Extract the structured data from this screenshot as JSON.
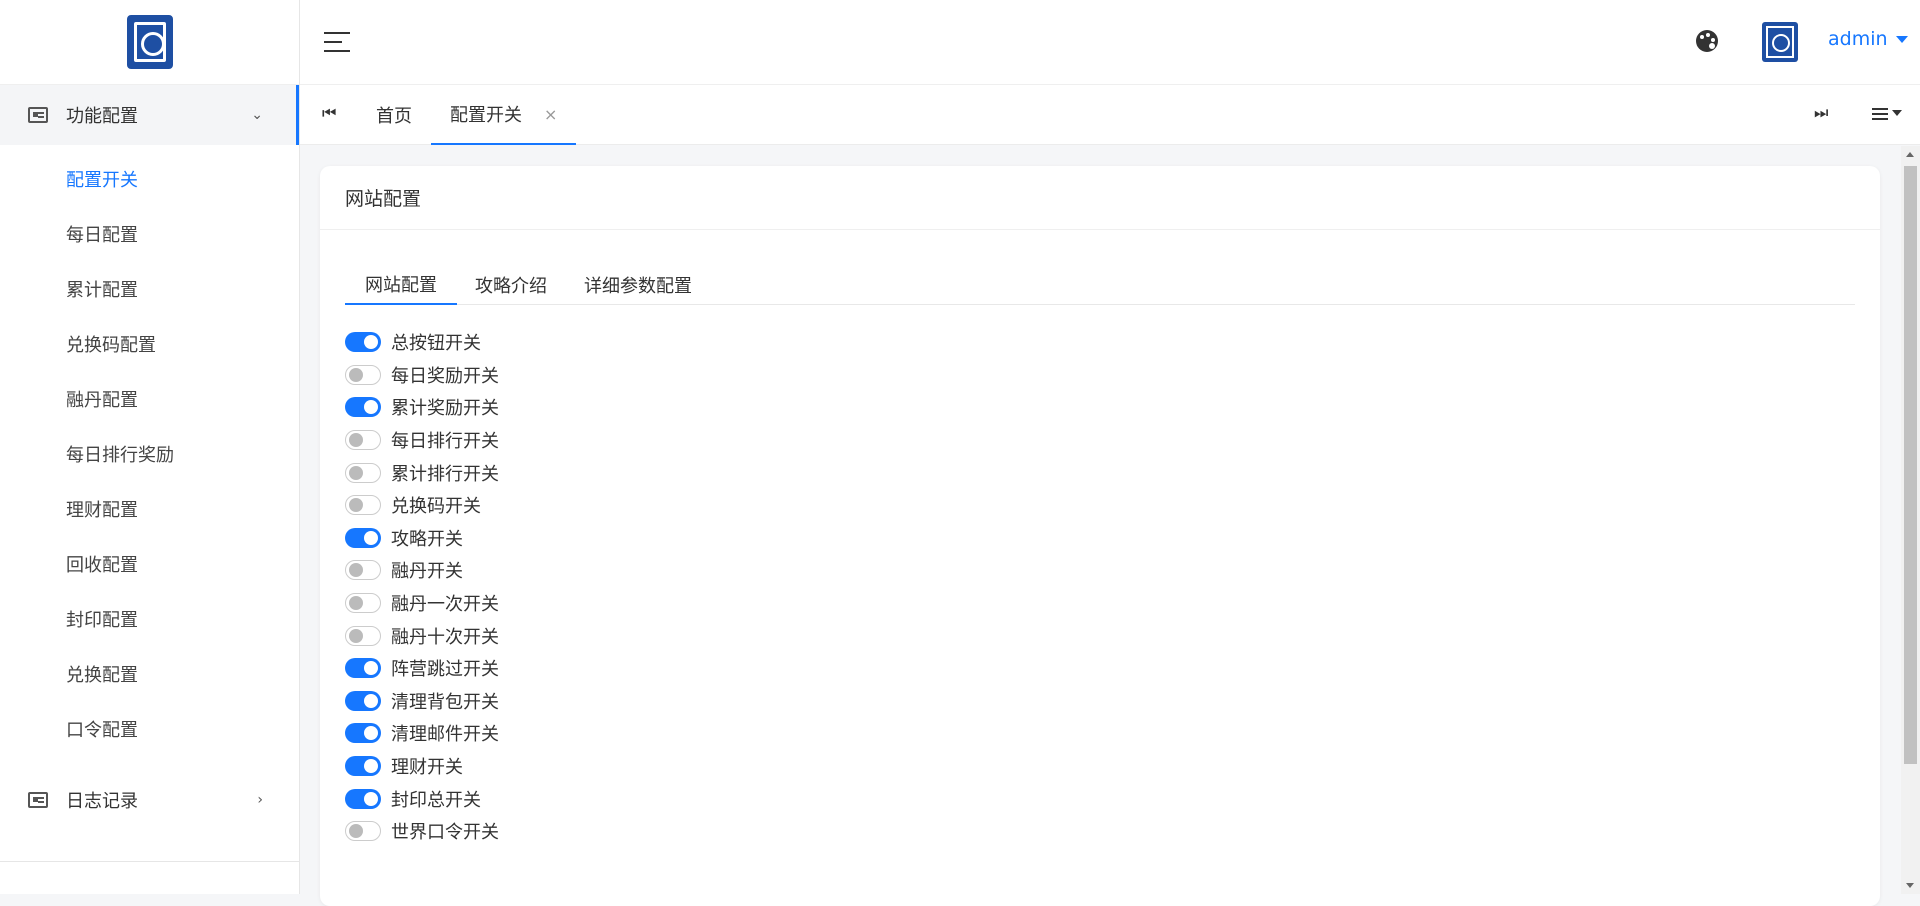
{
  "sidebar": {
    "groups": [
      {
        "label": "功能配置",
        "expanded": true,
        "items": [
          {
            "label": "配置开关",
            "active": true
          },
          {
            "label": "每日配置"
          },
          {
            "label": "累计配置"
          },
          {
            "label": "兑换码配置"
          },
          {
            "label": "融丹配置"
          },
          {
            "label": "每日排行奖励"
          },
          {
            "label": "理财配置"
          },
          {
            "label": "回收配置"
          },
          {
            "label": "封印配置"
          },
          {
            "label": "兑换配置"
          },
          {
            "label": "口令配置"
          }
        ]
      },
      {
        "label": "日志记录",
        "expanded": false
      }
    ]
  },
  "header": {
    "user": "admin"
  },
  "tabs": [
    {
      "label": "首页"
    },
    {
      "label": "配置开关",
      "active": true,
      "close": "×"
    }
  ],
  "card": {
    "title": "网站配置",
    "tabs": [
      {
        "label": "网站配置",
        "active": true
      },
      {
        "label": "攻略介绍"
      },
      {
        "label": "详细参数配置"
      }
    ],
    "switches": [
      {
        "label": "总按钮开关",
        "on": true
      },
      {
        "label": "每日奖励开关",
        "on": false
      },
      {
        "label": "累计奖励开关",
        "on": true
      },
      {
        "label": "每日排行开关",
        "on": false
      },
      {
        "label": "累计排行开关",
        "on": false
      },
      {
        "label": "兑换码开关",
        "on": false
      },
      {
        "label": "攻略开关",
        "on": true
      },
      {
        "label": "融丹开关",
        "on": false
      },
      {
        "label": "融丹一次开关",
        "on": false
      },
      {
        "label": "融丹十次开关",
        "on": false
      },
      {
        "label": "阵营跳过开关",
        "on": true
      },
      {
        "label": "清理背包开关",
        "on": true
      },
      {
        "label": "清理邮件开关",
        "on": true
      },
      {
        "label": "理财开关",
        "on": true
      },
      {
        "label": "封印总开关",
        "on": true
      },
      {
        "label": "世界口令开关",
        "on": false
      }
    ]
  },
  "colors": {
    "accent": "#1677ff",
    "switch_off": "#bbbbbb"
  }
}
